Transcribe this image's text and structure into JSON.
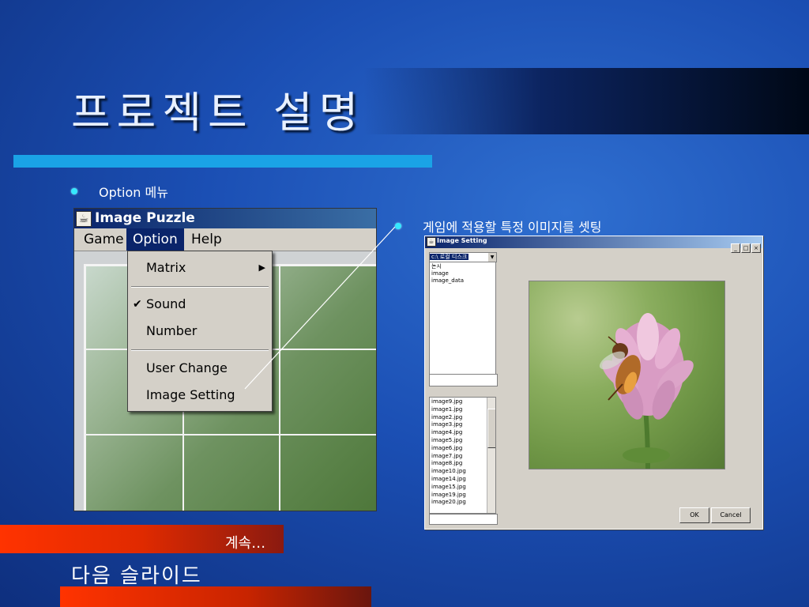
{
  "slide": {
    "title": "프로젝트 설명",
    "bullet1": "Option 메뉴",
    "bullet2": "게임에 적용할 특정 이미지를 셋팅",
    "continue_label": "계속…",
    "next_label": "다음 슬라이드"
  },
  "puzzle_window": {
    "title": "Image Puzzle",
    "menus": [
      "Game",
      "Option",
      "Help"
    ],
    "active_menu": "Option",
    "dropdown": {
      "matrix": "Matrix",
      "sound": "Sound",
      "sound_checked": true,
      "number": "Number",
      "user_change": "User Change",
      "image_setting": "Image Setting"
    },
    "board_grid": "3x3"
  },
  "setting_window": {
    "title": "Image Setting",
    "window_buttons": [
      "_",
      "□",
      "×"
    ],
    "drive": "c:\\ 로컬 디스크",
    "folders": [
      "논시",
      "image",
      "image_data"
    ],
    "files": [
      "image9.jpg",
      "image1.jpg",
      "image2.jpg",
      "image3.jpg",
      "image4.jpg",
      "image5.jpg",
      "image6.jpg",
      "image7.jpg",
      "image8.jpg",
      "image10.jpg",
      "image14.jpg",
      "image15.jpg",
      "image19.jpg",
      "image20.jpg"
    ],
    "ok": "OK",
    "cancel": "Cancel"
  },
  "colors": {
    "background": "#1b4fb4",
    "title_bar_accent": "#1aa3e6",
    "orange_bar": "#ff3300",
    "bullet": "#35e8ff"
  }
}
